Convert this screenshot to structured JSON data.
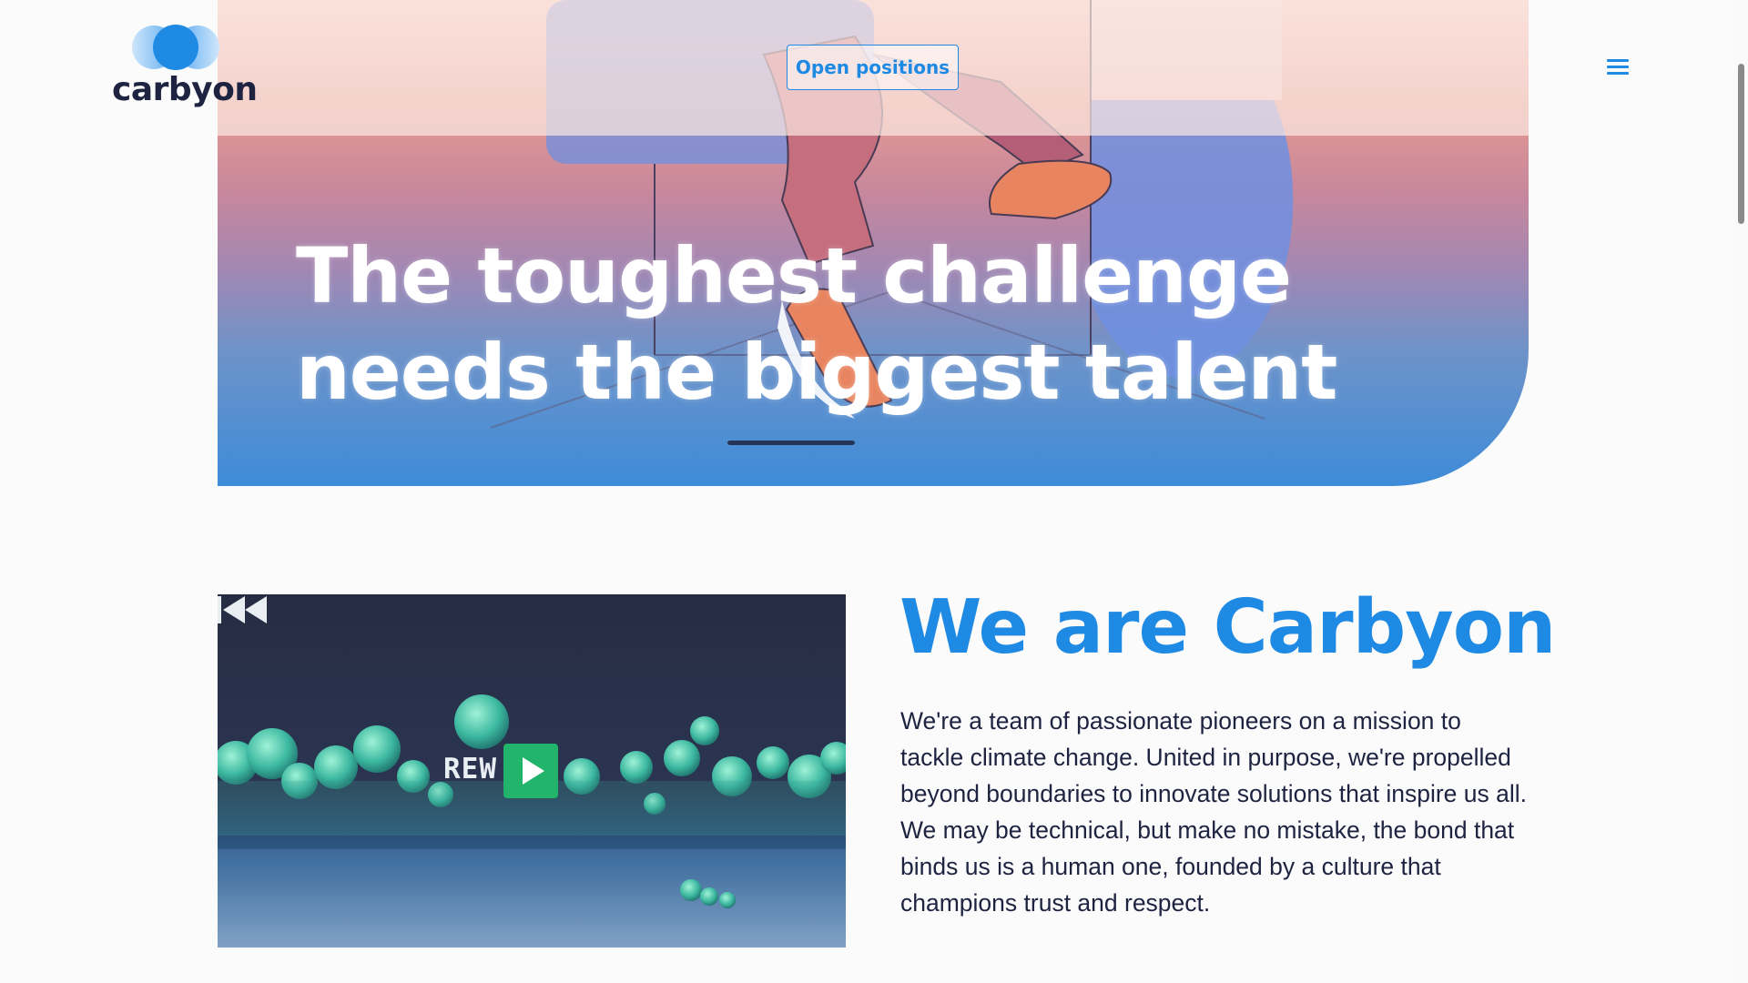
{
  "header": {
    "logo_text": "carbyon",
    "open_positions_label": "Open positions",
    "menu_icon": "hamburger-menu-icon"
  },
  "hero": {
    "title_line1": "The toughest challenge",
    "title_line2": "needs the biggest talent"
  },
  "about": {
    "title": "We are Carbyon",
    "body": "We're a team of passionate pioneers on a mission to tackle climate change. United in purpose, we're propelled beyond boundaries to innovate solutions that inspire us all. We may be technical, but make no mistake, the bond that binds us is a human one, founded by a culture that champions trust and respect."
  },
  "video": {
    "overlay_text": "REW",
    "play_icon": "play-icon",
    "rewind_icon": "rewind-icon"
  },
  "colors": {
    "accent": "#1f8ae3",
    "text": "#1d2340",
    "play_button": "#22b46a"
  }
}
